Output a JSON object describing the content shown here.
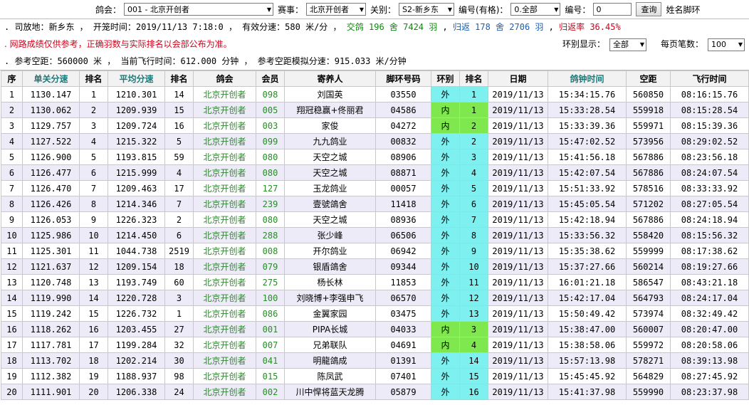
{
  "filters": {
    "club_label": "鸽会：",
    "club_value": "001 - 北京开创者",
    "race_label": "赛事：",
    "race_value": "北京开创者",
    "leg_label": "关别：",
    "leg_value": "S2-新乡东",
    "ring_label": "编号(有格)：",
    "ring_value": "0.全部",
    "number_label": "编号：",
    "number_value": "0",
    "query_button": "查询",
    "name_label": "姓名脚环"
  },
  "info": {
    "line1_prefix": ". 司放地：新乡东 ， 开笼时间：2019/11/13 7:18:0 ， 有效分速：580 米/分 ，",
    "arrived": "交鸽 196 舍 7424 羽",
    "returned": "归返 178 舍 2706 羽",
    "return_rate": "归返率 36.45%",
    "notice": ". 网路成绩仅供参考，正确羽数与实际排名以会部公布为准。",
    "ring_display_label": "环别显示：",
    "ring_display_value": "全部",
    "per_page_label": "每页笔数：",
    "per_page_value": "100",
    "line3": ". 参考空距：560000 米 ， 当前飞行时间：612.000 分钟 ， 参考空距模拟分速：915.033 米/分钟"
  },
  "table": {
    "headers": [
      "序",
      "单关分速",
      "排名",
      "平均分速",
      "排名",
      "鸽会",
      "会员",
      "寄养人",
      "脚环号码",
      "环别",
      "排名",
      "日期",
      "鸽钟时间",
      "空距",
      "飞行时间"
    ],
    "rows": [
      [
        "1",
        "1130.147",
        "1",
        "1210.301",
        "14",
        "北京开创者",
        "098",
        "刘国英",
        "03550",
        "外",
        "1",
        "2019/11/13",
        "15:34:15.76",
        "560850",
        "08:16:15.76"
      ],
      [
        "2",
        "1130.062",
        "2",
        "1209.939",
        "15",
        "北京开创者",
        "005",
        "翔冠稳赢+佟丽君",
        "04586",
        "内",
        "1",
        "2019/11/13",
        "15:33:28.54",
        "559918",
        "08:15:28.54"
      ],
      [
        "3",
        "1129.757",
        "3",
        "1209.724",
        "16",
        "北京开创者",
        "003",
        "家俊",
        "04272",
        "内",
        "2",
        "2019/11/13",
        "15:33:39.36",
        "559971",
        "08:15:39.36"
      ],
      [
        "4",
        "1127.522",
        "4",
        "1215.322",
        "5",
        "北京开创者",
        "099",
        "九九鸽业",
        "00832",
        "外",
        "2",
        "2019/11/13",
        "15:47:02.52",
        "573956",
        "08:29:02.52"
      ],
      [
        "5",
        "1126.900",
        "5",
        "1193.815",
        "59",
        "北京开创者",
        "080",
        "天空之城",
        "08906",
        "外",
        "3",
        "2019/11/13",
        "15:41:56.18",
        "567886",
        "08:23:56.18"
      ],
      [
        "6",
        "1126.477",
        "6",
        "1215.999",
        "4",
        "北京开创者",
        "080",
        "天空之城",
        "08871",
        "外",
        "4",
        "2019/11/13",
        "15:42:07.54",
        "567886",
        "08:24:07.54"
      ],
      [
        "7",
        "1126.470",
        "7",
        "1209.463",
        "17",
        "北京开创者",
        "127",
        "玉龙鸽业",
        "00057",
        "外",
        "5",
        "2019/11/13",
        "15:51:33.92",
        "578516",
        "08:33:33.92"
      ],
      [
        "8",
        "1126.426",
        "8",
        "1214.346",
        "7",
        "北京开创者",
        "239",
        "壹號鴿舍",
        "11418",
        "外",
        "6",
        "2019/11/13",
        "15:45:05.54",
        "571202",
        "08:27:05.54"
      ],
      [
        "9",
        "1126.053",
        "9",
        "1226.323",
        "2",
        "北京开创者",
        "080",
        "天空之城",
        "08936",
        "外",
        "7",
        "2019/11/13",
        "15:42:18.94",
        "567886",
        "08:24:18.94"
      ],
      [
        "10",
        "1125.986",
        "10",
        "1214.450",
        "6",
        "北京开创者",
        "288",
        "张少峰",
        "06506",
        "外",
        "8",
        "2019/11/13",
        "15:33:56.32",
        "558420",
        "08:15:56.32"
      ],
      [
        "11",
        "1125.301",
        "11",
        "1044.738",
        "2519",
        "北京开创者",
        "008",
        "开尔鸽业",
        "06942",
        "外",
        "9",
        "2019/11/13",
        "15:35:38.62",
        "559999",
        "08:17:38.62"
      ],
      [
        "12",
        "1121.637",
        "12",
        "1209.154",
        "18",
        "北京开创者",
        "079",
        "银盾鴿舍",
        "09344",
        "外",
        "10",
        "2019/11/13",
        "15:37:27.66",
        "560214",
        "08:19:27.66"
      ],
      [
        "13",
        "1120.748",
        "13",
        "1193.749",
        "60",
        "北京开创者",
        "275",
        "杨长林",
        "11853",
        "外",
        "11",
        "2019/11/13",
        "16:01:21.18",
        "586547",
        "08:43:21.18"
      ],
      [
        "14",
        "1119.990",
        "14",
        "1220.728",
        "3",
        "北京开创者",
        "100",
        "刘晓博+李强申飞",
        "06570",
        "外",
        "12",
        "2019/11/13",
        "15:42:17.04",
        "564793",
        "08:24:17.04"
      ],
      [
        "15",
        "1119.242",
        "15",
        "1226.732",
        "1",
        "北京开创者",
        "086",
        "金翼家园",
        "03475",
        "外",
        "13",
        "2019/11/13",
        "15:50:49.42",
        "573974",
        "08:32:49.42"
      ],
      [
        "16",
        "1118.262",
        "16",
        "1203.455",
        "27",
        "北京开创者",
        "001",
        "PIPA长城",
        "04033",
        "内",
        "3",
        "2019/11/13",
        "15:38:47.00",
        "560007",
        "08:20:47.00"
      ],
      [
        "17",
        "1117.781",
        "17",
        "1199.284",
        "32",
        "北京开创者",
        "007",
        "兄弟联队",
        "04691",
        "内",
        "4",
        "2019/11/13",
        "15:38:58.06",
        "559972",
        "08:20:58.06"
      ],
      [
        "18",
        "1113.702",
        "18",
        "1202.214",
        "30",
        "北京开创者",
        "041",
        "明龍鴿成",
        "01391",
        "外",
        "14",
        "2019/11/13",
        "15:57:13.98",
        "578271",
        "08:39:13.98"
      ],
      [
        "19",
        "1112.382",
        "19",
        "1188.937",
        "98",
        "北京开创者",
        "015",
        "陈凤武",
        "07401",
        "外",
        "15",
        "2019/11/13",
        "15:45:45.92",
        "564829",
        "08:27:45.92"
      ],
      [
        "20",
        "1111.901",
        "20",
        "1206.338",
        "24",
        "北京开创者",
        "002",
        "川中悍将蓝天龙腾",
        "05879",
        "外",
        "16",
        "2019/11/13",
        "15:41:37.98",
        "559990",
        "08:23:37.98"
      ]
    ]
  }
}
